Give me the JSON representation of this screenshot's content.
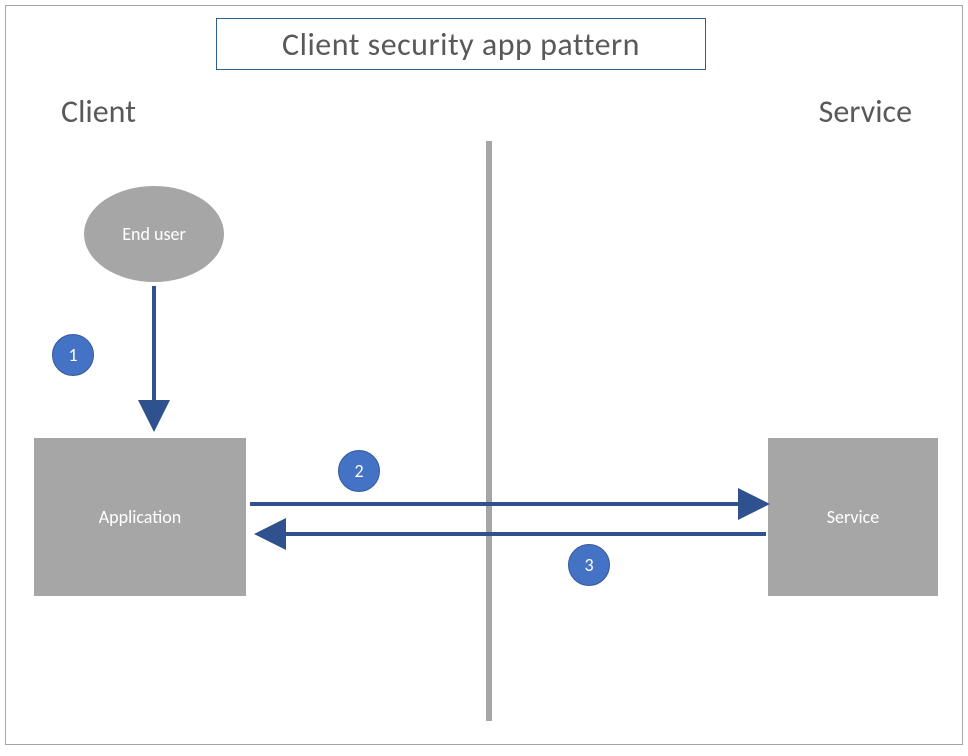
{
  "title": "Client security app pattern",
  "sections": {
    "left": "Client",
    "right": "Service"
  },
  "nodes": {
    "end_user": "End user",
    "application": "Application",
    "service": "Service"
  },
  "steps": {
    "s1": "1",
    "s2": "2",
    "s3": "3"
  },
  "arrows": [
    {
      "from": "end_user",
      "to": "application",
      "label_step": 1
    },
    {
      "from": "application",
      "to": "service",
      "label_step": 2
    },
    {
      "from": "service",
      "to": "application",
      "label_step": 3
    }
  ],
  "colors": {
    "node_fill": "#a6a6a6",
    "arrow": "#2f528f",
    "badge": "#4472c4",
    "title_border": "#2e5c9a",
    "text_dark": "#595959"
  }
}
